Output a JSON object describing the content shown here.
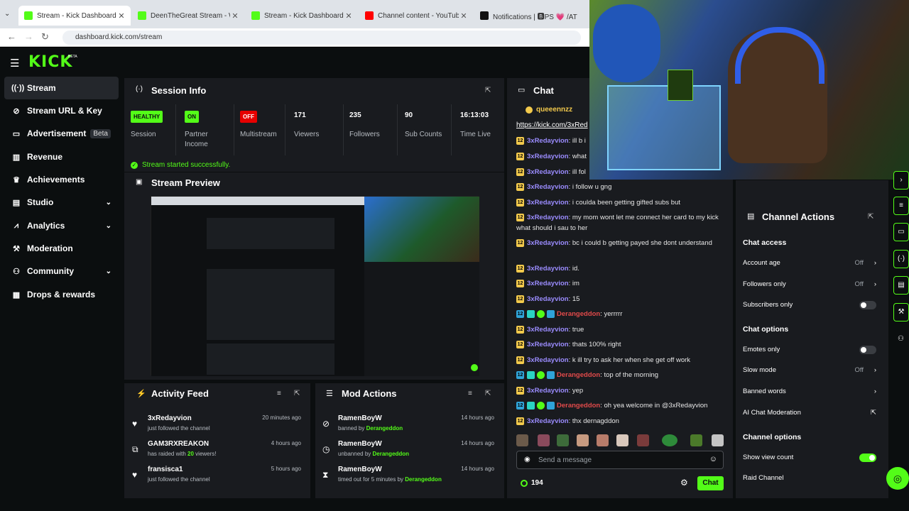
{
  "browser": {
    "tabs": [
      {
        "label": "Stream - Kick Dashboard",
        "icon": "kick-favicon",
        "active": true
      },
      {
        "label": "DeenTheGreat Stream - Watch",
        "icon": "kick-favicon",
        "active": false
      },
      {
        "label": "Stream - Kick Dashboard",
        "icon": "kick-favicon",
        "active": false
      },
      {
        "label": "Channel content - YouTube Stu",
        "icon": "youtube-favicon",
        "active": false
      },
      {
        "label": "Notifications | 🅱PS 💗 /AT",
        "icon": "notifications-favicon",
        "active": false
      }
    ],
    "url": "dashboard.kick.com/stream"
  },
  "app": {
    "logo": "KICK",
    "logo_tag": "BETA",
    "accent_color": "#53fc18"
  },
  "sidebar": {
    "items": [
      {
        "label": "Stream",
        "icon": "broadcast-icon",
        "active": true
      },
      {
        "label": "Stream URL & Key",
        "icon": "link-icon"
      },
      {
        "label": "Advertisement",
        "icon": "monitor-icon",
        "badge": "Beta"
      },
      {
        "label": "Revenue",
        "icon": "bar-chart-icon"
      },
      {
        "label": "Achievements",
        "icon": "trophy-icon"
      },
      {
        "label": "Studio",
        "icon": "studio-icon",
        "expandable": true
      },
      {
        "label": "Analytics",
        "icon": "analytics-icon",
        "expandable": true
      },
      {
        "label": "Moderation",
        "icon": "hammer-icon"
      },
      {
        "label": "Community",
        "icon": "community-icon",
        "expandable": true
      },
      {
        "label": "Drops & rewards",
        "icon": "gift-icon"
      }
    ]
  },
  "session": {
    "title": "Session Info",
    "stats": [
      {
        "badge": "HEALTHY",
        "label": "Session",
        "badge_color": "#53fc18"
      },
      {
        "badge": "ON",
        "label": "Partner\nIncome",
        "badge_color": "#53fc18"
      },
      {
        "badge": "OFF",
        "label": "Multistream",
        "badge_color": "#e60000"
      },
      {
        "value": "171",
        "label": "Viewers"
      },
      {
        "value": "235",
        "label": "Followers"
      },
      {
        "value": "90",
        "label": "Sub Counts"
      },
      {
        "value": "16:13:03",
        "label": "Time Live"
      }
    ],
    "status": "Stream started successfully."
  },
  "preview": {
    "title": "Stream Preview"
  },
  "activity_feed": {
    "title": "Activity Feed",
    "items": [
      {
        "name": "3xRedayvion",
        "sub": "just followed the channel",
        "time": "20 minutes ago",
        "icon": "heart-icon"
      },
      {
        "name": "GAM3RXREAKON",
        "sub_pre": "has raided with ",
        "sub_hl": "20",
        "sub_post": " viewers!",
        "time": "4 hours ago",
        "icon": "raid-icon"
      },
      {
        "name": "fransisca1",
        "sub": "just followed the channel",
        "time": "5 hours ago",
        "icon": "heart-icon"
      }
    ]
  },
  "mod_actions": {
    "title": "Mod Actions",
    "items": [
      {
        "name": "RamenBoyW",
        "sub_pre": "banned by ",
        "sub_hl": "Derangeddon",
        "time": "14 hours ago",
        "icon": "ban-icon"
      },
      {
        "name": "RamenBoyW",
        "sub_pre": "unbanned by ",
        "sub_hl": "Derangeddon",
        "time": "14 hours ago",
        "icon": "clock-icon"
      },
      {
        "name": "RamenBoyW",
        "sub_pre": "timed out for 5 minutes by ",
        "sub_hl": "Derangeddon",
        "time": "14 hours ago",
        "icon": "hourglass-icon"
      }
    ]
  },
  "chat": {
    "title": "Chat",
    "pinned_user": "queeennzz",
    "link": "https://kick.com/3xRed",
    "messages": [
      {
        "user": "3xRedayvion",
        "text": ": ill b i",
        "badges": "sub"
      },
      {
        "user": "3xRedayvion",
        "text": ": what",
        "badges": "sub"
      },
      {
        "user": "3xRedayvion",
        "text": ": ill fol",
        "badges": "sub"
      },
      {
        "user": "3xRedayvion",
        "text": ": i follow u gng",
        "badges": "sub"
      },
      {
        "user": "3xRedayvion",
        "text": ": i coulda been getting gifted subs but",
        "badges": "sub"
      },
      {
        "user": "3xRedayvion",
        "text": ": my mom wont let me connect her card to my kick what should i sau to her",
        "badges": "sub"
      },
      {
        "user": "3xRedayvion",
        "text": ": bc i could b getting payed she dont understand",
        "badges": "sub"
      },
      {
        "user": "3xRedayvion",
        "text": ": id.",
        "badges": "sub"
      },
      {
        "user": "3xRedayvion",
        "text": ": im",
        "badges": "sub"
      },
      {
        "user": "3xRedayvion",
        "text": ": 15",
        "badges": "sub"
      },
      {
        "user": "Derangeddon",
        "text": ": yerrrrr",
        "badges": "mod"
      },
      {
        "user": "3xRedayvion",
        "text": ": true",
        "badges": "sub"
      },
      {
        "user": "3xRedayvion",
        "text": ": thats 100% right",
        "badges": "sub"
      },
      {
        "user": "3xRedayvion",
        "text": ": k ill try to ask her when she get off work",
        "badges": "sub"
      },
      {
        "user": "Derangeddon",
        "text": ": top of the morning",
        "badges": "mod"
      },
      {
        "user": "3xRedayvion",
        "text": ": yep",
        "badges": "sub"
      },
      {
        "user": "Derangeddon",
        "text": ": oh yea welcome in @3xRedayvion",
        "badges": "mod"
      },
      {
        "user": "3xRedayvion",
        "text": ": thx dernagddon",
        "badges": "sub"
      }
    ],
    "badge_text": "12",
    "input_placeholder": "Send a message",
    "viewer_count": "194",
    "send_label": "Chat"
  },
  "channel_actions": {
    "title": "Channel Actions",
    "sections": {
      "chat_access": "Chat access",
      "chat_options": "Chat options",
      "channel_options": "Channel options"
    },
    "rows": {
      "account_age": {
        "label": "Account age",
        "value": "Off"
      },
      "followers_only": {
        "label": "Followers only",
        "value": "Off"
      },
      "subscribers_only": {
        "label": "Subscribers only",
        "toggle": false
      },
      "emotes_only": {
        "label": "Emotes only",
        "toggle": false
      },
      "slow_mode": {
        "label": "Slow mode",
        "value": "Off"
      },
      "banned_words": {
        "label": "Banned words"
      },
      "ai_moderation": {
        "label": "AI Chat Moderation"
      },
      "show_view_count": {
        "label": "Show view count",
        "toggle": true
      },
      "raid_channel": {
        "label": "Raid Channel"
      }
    }
  }
}
